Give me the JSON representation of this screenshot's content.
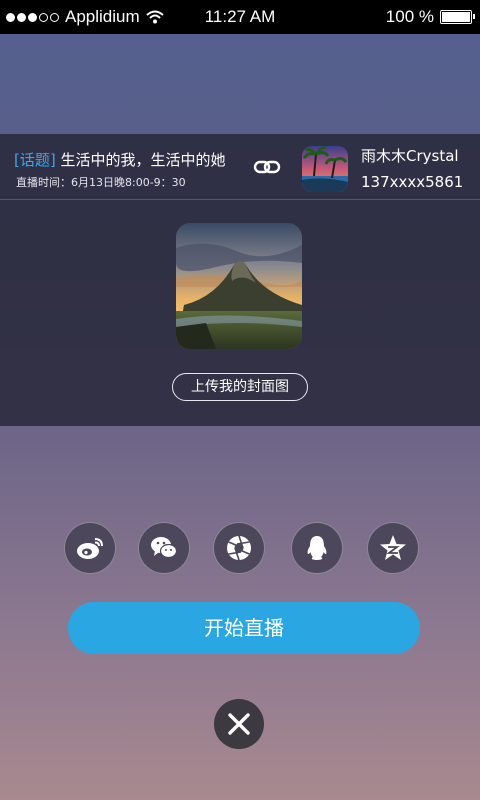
{
  "status_bar": {
    "carrier": "Applidium",
    "time": "11:27 AM",
    "battery": "100 %"
  },
  "live_info": {
    "topic_tag": "[话题]",
    "topic_text": "生活中的我，生活中的她",
    "schedule": "直播时间：6月13日晚8:00-9：30",
    "user_name": "雨木木Crystal",
    "user_phone": "137xxxx5861"
  },
  "cover": {
    "upload_label": "上传我的封面图"
  },
  "share": {
    "icons": [
      "weibo-icon",
      "wechat-icon",
      "moments-icon",
      "qq-icon",
      "qzone-icon"
    ]
  },
  "actions": {
    "start_label": "开始直播",
    "close_label": "X"
  },
  "colors": {
    "accent": "#2aa6e2",
    "topic_tag": "#3fa6e8"
  }
}
